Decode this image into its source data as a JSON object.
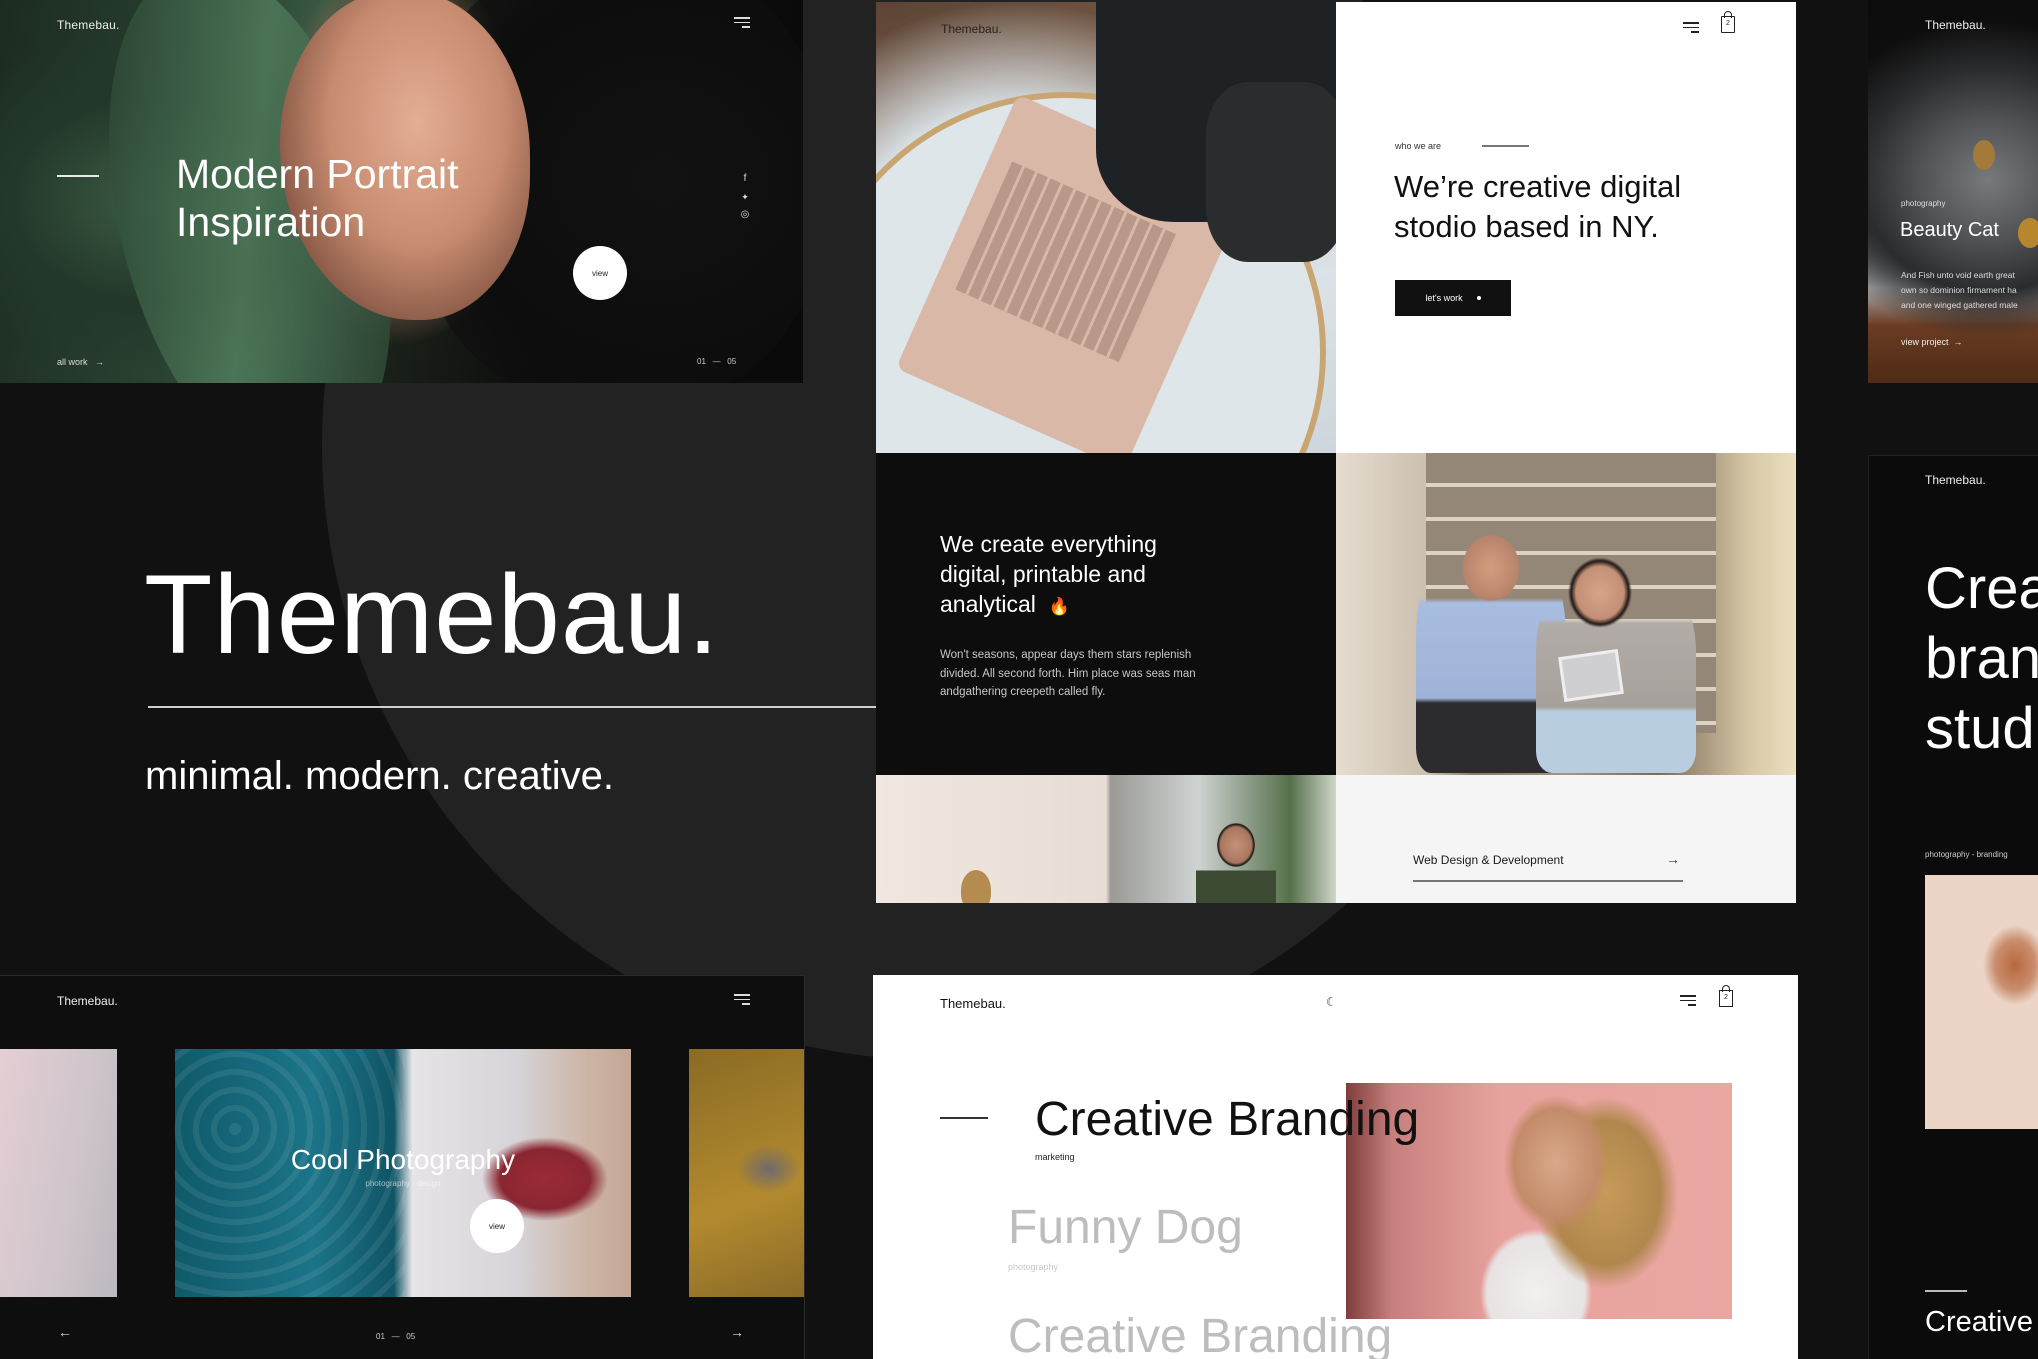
{
  "brand": "Themebau.",
  "hero": {
    "title": "Themebau.",
    "tagline": "minimal. modern. creative."
  },
  "portrait_panel": {
    "brand": "Themebau.",
    "title_line1": "Modern Portrait",
    "title_line2": "Inspiration",
    "social": [
      {
        "icon": "facebook-icon",
        "glyph": "f"
      },
      {
        "icon": "twitter-icon",
        "glyph": "🐦"
      },
      {
        "icon": "instagram-icon",
        "glyph": "◎"
      }
    ],
    "view_label": "view",
    "all_work_label": "all work",
    "arrow": "→",
    "pager_current": "01",
    "pager_total": "05",
    "pager_sep": "—"
  },
  "studio_panel": {
    "brand": "Themebau.",
    "eyebrow": "who we are",
    "heading_line1": "We’re creative digital",
    "heading_line2": "stodio based in NY.",
    "cta_label": "let's work",
    "cart_count": "2"
  },
  "create_panel": {
    "heading_line1": "We create everything",
    "heading_line2": "digital, printable and",
    "heading_line3": "analytical",
    "emoji": "🔥",
    "body_line1": "Won't seasons, appear days them stars replenish",
    "body_line2": "divided. All second forth. Him place was seas man",
    "body_line3": "andgathering creepeth called fly."
  },
  "services_panel": {
    "label": "Web Design & Development",
    "arrow": "→"
  },
  "cat_panel": {
    "brand": "Themebau.",
    "category": "photography",
    "title": "Beauty Cat",
    "desc_line1": "And Fish unto void earth great",
    "desc_line2": "own so dominion firmament ha",
    "desc_line3": "and one winged gathered male",
    "link_label": "view project",
    "arrow": "→"
  },
  "branding_dark_panel": {
    "brand": "Themebau.",
    "big_line1": "Crea",
    "big_line2": "bran",
    "big_line3": "stud",
    "category": "photography - branding",
    "bottom_title": "Creative"
  },
  "slider_panel": {
    "brand": "Themebau.",
    "title": "Cool Photography",
    "subtitle": "photography - design",
    "view_label": "view",
    "prev_arrow": "←",
    "next_arrow": "→",
    "pager_current": "01",
    "pager_total": "05",
    "pager_sep": "—"
  },
  "portfolio_list_panel": {
    "brand": "Themebau.",
    "moon_glyph": "☾",
    "cart_count": "2",
    "items": [
      {
        "title": "Creative Branding",
        "category": "marketing",
        "active": true
      },
      {
        "title": "Funny Dog",
        "category": "photography",
        "active": false
      },
      {
        "title": "Creative Branding",
        "category": "",
        "active": false
      }
    ]
  }
}
